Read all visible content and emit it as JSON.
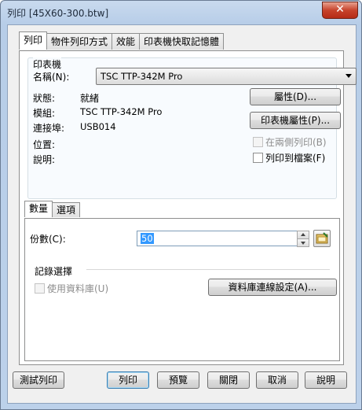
{
  "window": {
    "title": "列印 [45X60-300.btw]",
    "close_glyph": "✕"
  },
  "tabs": [
    "列印",
    "物件列印方式",
    "效能",
    "印表機快取記憶體"
  ],
  "printer": {
    "group_label": "印表機",
    "name_label": "名稱(N):",
    "name_value": "TSC TTP-342M Pro",
    "status_label": "狀態:",
    "status_value": "就緒",
    "model_label": "模組:",
    "model_value": "TSC TTP-342M Pro",
    "port_label": "連接埠:",
    "port_value": "USB014",
    "location_label": "位置:",
    "location_value": "",
    "comment_label": "說明:",
    "comment_value": "",
    "properties_button": "屬性(D)...",
    "printer_properties_button": "印表機屬性(P)...",
    "duplex_label": "在兩側列印(B)",
    "print_to_file_label": "列印到檔案(F)"
  },
  "subtabs": [
    "數量",
    "選項"
  ],
  "quantity": {
    "copies_label": "份數(C):",
    "copies_value": "50",
    "records_label": "記錄選擇",
    "use_db_label": "使用資料庫(U)",
    "db_conn_button": "資料庫連線設定(A)..."
  },
  "footer": {
    "test_print": "測試列印",
    "print": "列印",
    "preview": "預覽",
    "close": "關閉",
    "cancel": "取消",
    "help": "說明"
  },
  "colors": {
    "titlebar": "#b7cde8",
    "close": "#c7432c",
    "selection": "#3399ff"
  }
}
